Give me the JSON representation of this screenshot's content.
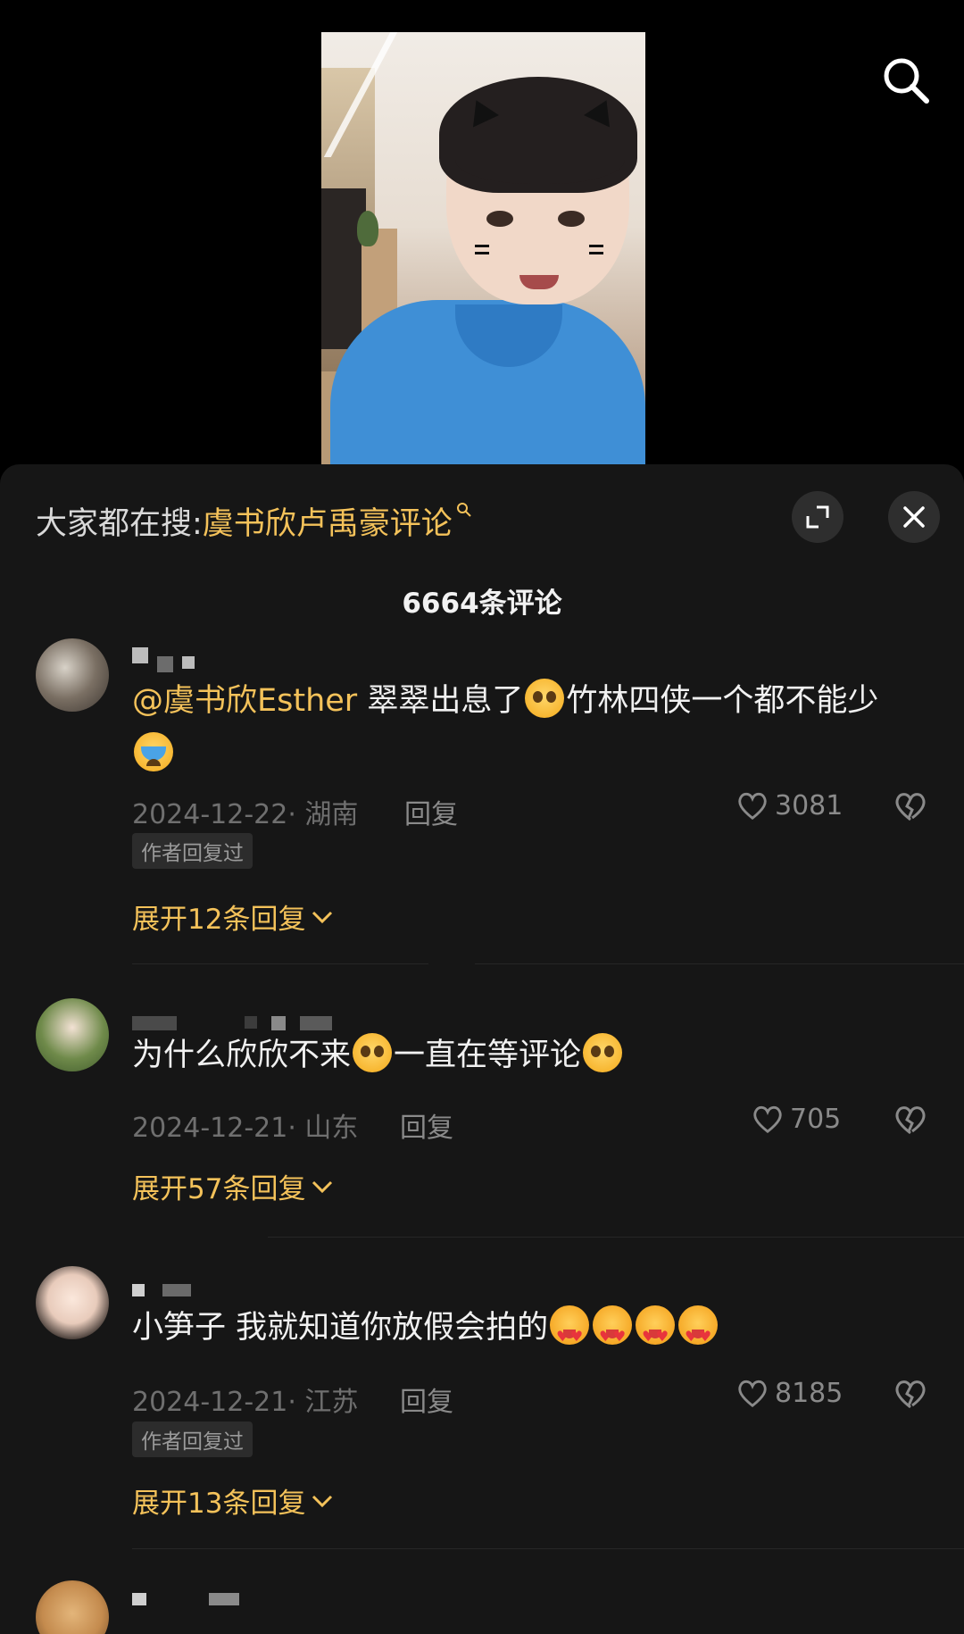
{
  "colors": {
    "accent": "#f4c25a",
    "sheet_bg": "#161616",
    "muted": "#6f6f6f"
  },
  "header": {
    "search_prefix": "大家都在搜:",
    "search_keyword": "虞书欣卢禹豪评论",
    "search_icon": "search-icon",
    "expand_icon": "expand-icon",
    "close_icon": "close-icon"
  },
  "comment_count": "6664条评论",
  "comments": [
    {
      "mention": "@虞书欣Esther",
      "text_1": " 翠翠出息了",
      "text_2": "竹林四侠一个都不能少",
      "emojis": [
        "pleading-face",
        "loudly-crying-face"
      ],
      "date_location": "2024-12-22· 湖南",
      "reply_label": "回复",
      "likes": "3081",
      "author_badge": "作者回复过",
      "expand_label": "展开12条回复"
    },
    {
      "text_1": "为什么欣欣不来",
      "text_2": "一直在等评论",
      "emojis": [
        "pleading-face",
        "pleading-face"
      ],
      "date_location": "2024-12-21· 山东",
      "reply_label": "回复",
      "likes": "705",
      "expand_label": "展开57条回复"
    },
    {
      "text_1": "小笋子 我就知道你放假会拍的",
      "emojis": [
        "star-struck",
        "star-struck",
        "star-struck",
        "star-struck"
      ],
      "date_location": "2024-12-21· 江苏",
      "reply_label": "回复",
      "likes": "8185",
      "author_badge": "作者回复过",
      "expand_label": "展开13条回复"
    }
  ]
}
